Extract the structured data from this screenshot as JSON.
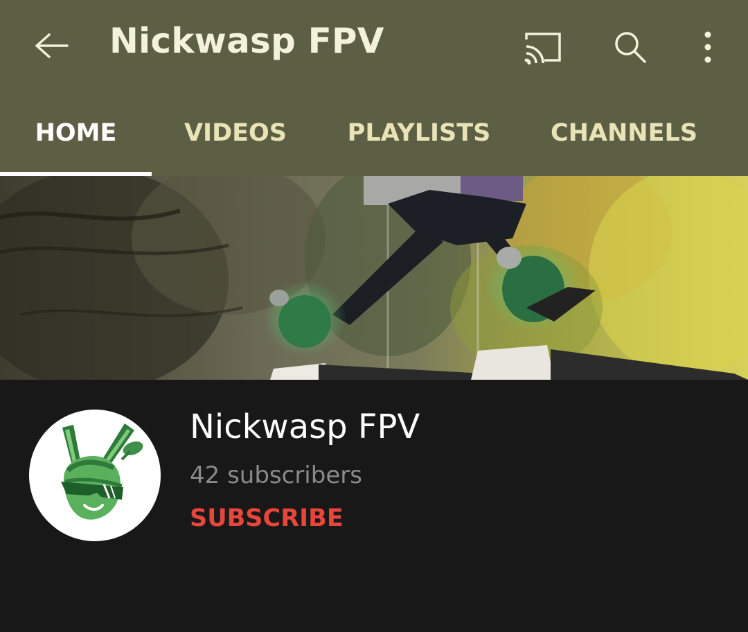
{
  "appbar": {
    "title": "Nickwasp FPV",
    "back_icon": "arrow-back-icon",
    "actions": [
      "cast-icon",
      "search-icon",
      "more-vert-icon"
    ],
    "background": "#5d5f45"
  },
  "tabs": [
    {
      "label": "HOME",
      "active": true
    },
    {
      "label": "VIDEOS",
      "active": false
    },
    {
      "label": "PLAYLISTS",
      "active": false
    },
    {
      "label": "CHANNELS",
      "active": false
    }
  ],
  "channel": {
    "name": "Nickwasp FPV",
    "subscribers": "42 subscribers",
    "subscribe_label": "SUBSCRIBE",
    "accent": "#e8453c"
  }
}
